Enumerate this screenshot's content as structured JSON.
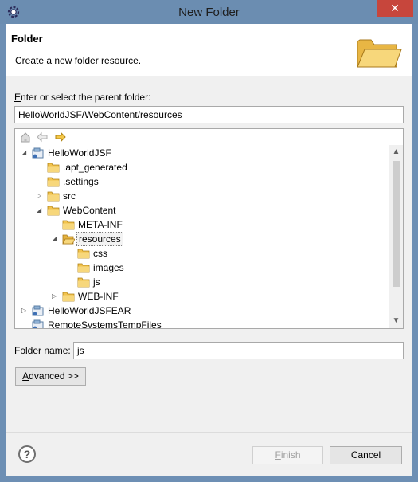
{
  "window": {
    "title": "New Folder",
    "close_glyph": "✕",
    "icon": "eclipse-gear-icon"
  },
  "banner": {
    "title": "Folder",
    "message": "Create a new folder resource.",
    "image": "open-folder-icon"
  },
  "parent": {
    "label_first": "E",
    "label_rest": "nter or select the parent folder:",
    "value": "HelloWorldJSF/WebContent/resources"
  },
  "toolbar": {
    "home": "home-icon",
    "back": "back-arrow-icon",
    "forward": "forward-arrow-icon"
  },
  "tree": {
    "rows": [
      {
        "label": "HelloWorldJSF",
        "twisty": "expanded",
        "icon": "project",
        "selected": false
      },
      {
        "label": ".apt_generated",
        "twisty": "none",
        "icon": "folder",
        "selected": false
      },
      {
        "label": ".settings",
        "twisty": "none",
        "icon": "folder",
        "selected": false
      },
      {
        "label": "src",
        "twisty": "collapsed",
        "icon": "folder",
        "selected": false
      },
      {
        "label": "WebContent",
        "twisty": "expanded",
        "icon": "folder",
        "selected": false
      },
      {
        "label": "META-INF",
        "twisty": "none",
        "icon": "folder",
        "selected": false
      },
      {
        "label": "resources",
        "twisty": "expanded",
        "icon": "folder-open",
        "selected": true
      },
      {
        "label": "css",
        "twisty": "none",
        "icon": "folder",
        "selected": false
      },
      {
        "label": "images",
        "twisty": "none",
        "icon": "folder",
        "selected": false
      },
      {
        "label": "js",
        "twisty": "none",
        "icon": "folder",
        "selected": false
      },
      {
        "label": "WEB-INF",
        "twisty": "collapsed",
        "icon": "folder",
        "selected": false
      },
      {
        "label": "HelloWorldJSFEAR",
        "twisty": "collapsed",
        "icon": "project",
        "selected": false
      },
      {
        "label": "RemoteSystemsTempFiles",
        "twisty": "none",
        "icon": "project-open",
        "selected": false
      }
    ]
  },
  "folder_name": {
    "label_pre": "Folder ",
    "label_u": "n",
    "label_post": "ame:",
    "value": "js"
  },
  "advanced": {
    "pre": "",
    "u": "A",
    "post": "dvanced >>"
  },
  "buttons": {
    "finish_u": "F",
    "finish_rest": "inish",
    "cancel": "Cancel"
  },
  "help_glyph": "?",
  "colors": {
    "title_bar": "#6b8db1",
    "close": "#c7463c",
    "folder": "#f2c34e",
    "dialog_bg": "#f0f0f0"
  }
}
